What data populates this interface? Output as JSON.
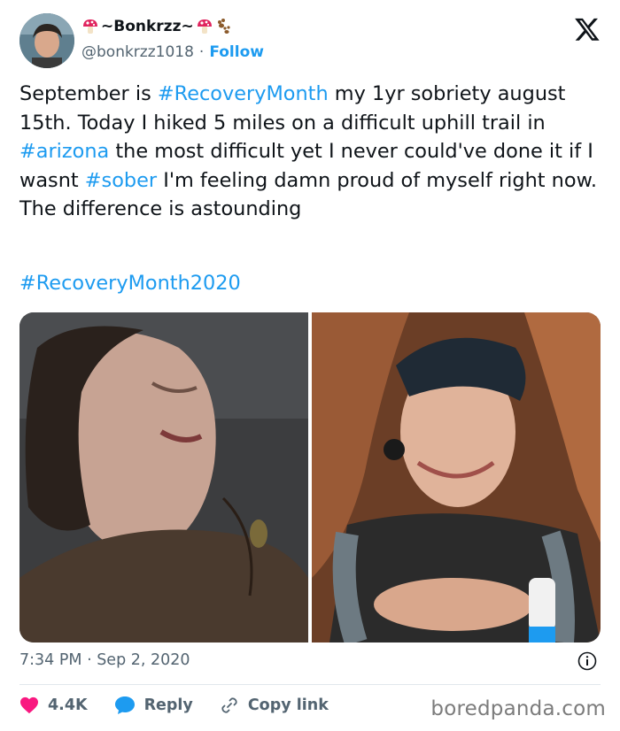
{
  "author": {
    "display_name": "~Bonkrzz~",
    "handle": "@bonkrzz1018",
    "follow_label": "Follow"
  },
  "tweet": {
    "text_parts": [
      {
        "t": "September is ",
        "tag": false
      },
      {
        "t": "#RecoveryMonth",
        "tag": true
      },
      {
        "t": " my 1yr sobriety august 15th. Today I hiked 5 miles on a difficult uphill trail in ",
        "tag": false
      },
      {
        "t": "#arizona",
        "tag": true
      },
      {
        "t": " the most difficult yet I never could've done it if I wasnt ",
        "tag": false
      },
      {
        "t": "#sober",
        "tag": true
      },
      {
        "t": " I'm feeling damn proud of myself right now. The difference is astounding",
        "tag": false
      }
    ],
    "hashtag_line": "#RecoveryMonth2020",
    "timestamp": "7:34 PM · Sep 2, 2020"
  },
  "actions": {
    "like_count": "4.4K",
    "reply_label": "Reply",
    "copy_link_label": "Copy link"
  },
  "watermark": "boredpanda.com",
  "colors": {
    "link": "#1d9bf0",
    "like": "#f91880",
    "reply": "#1d9bf0",
    "muted": "#536471"
  }
}
